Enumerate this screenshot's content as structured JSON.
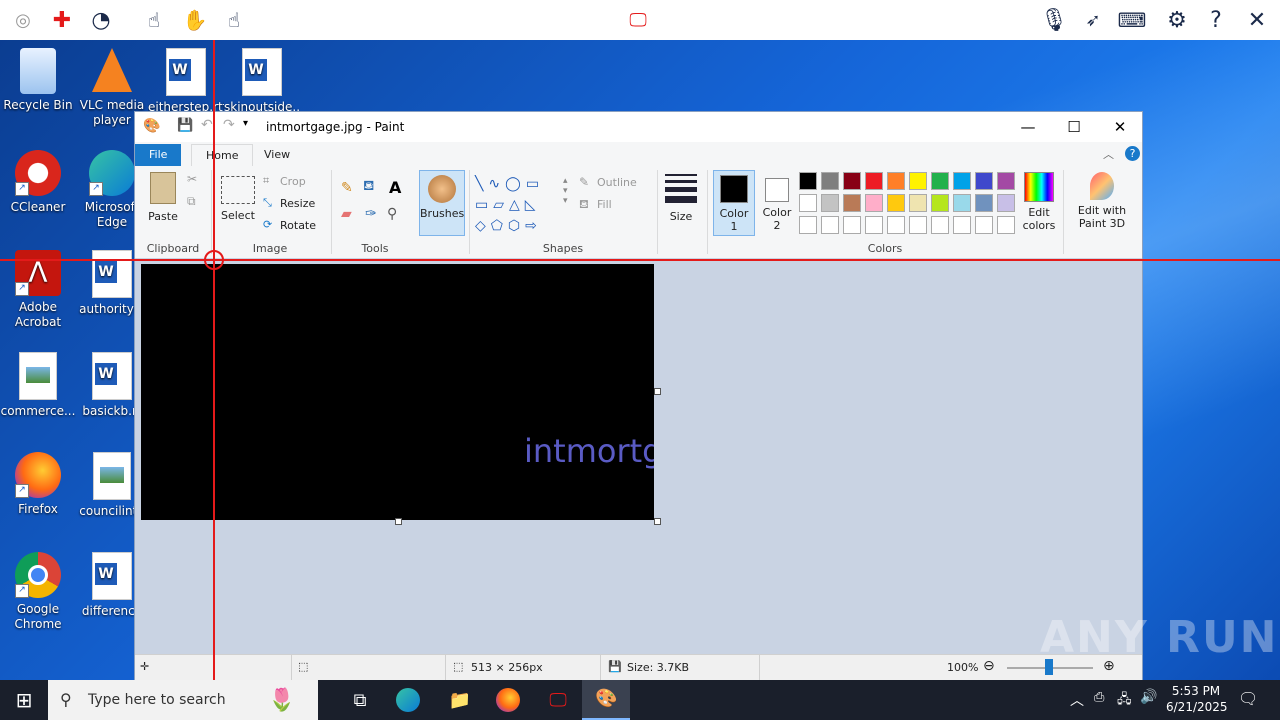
{
  "toolbar": {
    "icons": [
      "webcam-icon",
      "target-icon",
      "gauge-icon",
      "hand-click-icon",
      "hand-double-click-icon",
      "hand-hold-icon",
      "remote-desktop-icon",
      "microphone-icon",
      "pointer-icon",
      "keyboard-icon",
      "gear-icon",
      "help-icon",
      "close-icon"
    ]
  },
  "desktop": {
    "icons": [
      {
        "label": "Recycle Bin"
      },
      {
        "label": "VLC media player"
      },
      {
        "label": "eitherstep.rtf"
      },
      {
        "label": "skinoutside..."
      },
      {
        "label": "CCleaner"
      },
      {
        "label": "Microsoft Edge"
      },
      {
        "label": "Adobe Acrobat"
      },
      {
        "label": "authorityst"
      },
      {
        "label": "commerce..."
      },
      {
        "label": "basickb.rt"
      },
      {
        "label": "Firefox"
      },
      {
        "label": "councilinte"
      },
      {
        "label": "Google Chrome"
      },
      {
        "label": "difference"
      }
    ]
  },
  "paint": {
    "title": "intmortgage.jpg - Paint",
    "tabs": {
      "file": "File",
      "home": "Home",
      "view": "View"
    },
    "ribbon": {
      "paste": "Paste",
      "select": "Select",
      "crop": "Crop",
      "resize": "Resize",
      "rotate": "Rotate",
      "brushes": "Brushes",
      "outline": "Outline",
      "fill": "Fill",
      "size": "Size",
      "color1": "Color 1",
      "color2": "Color 2",
      "edit_colors": "Edit colors",
      "edit_paint3d": "Edit with Paint 3D",
      "groups": {
        "clipboard": "Clipboard",
        "image": "Image",
        "tools": "Tools",
        "shapes": "Shapes",
        "colors": "Colors"
      },
      "palette_row1": [
        "#000000",
        "#7f7f7f",
        "#880015",
        "#ed1c24",
        "#ff7f27",
        "#fff200",
        "#22b14c",
        "#00a2e8",
        "#3f48cc",
        "#a349a4"
      ],
      "palette_row2": [
        "#ffffff",
        "#c3c3c3",
        "#b97a57",
        "#ffaec9",
        "#ffc90e",
        "#efe4b0",
        "#b5e61d",
        "#99d9ea",
        "#7092be",
        "#c8bfe7"
      ]
    },
    "image_text": "intmortgage",
    "status": {
      "dimensions": "513 × 256px",
      "size": "Size: 3.7KB",
      "zoom": "100%"
    }
  },
  "taskbar": {
    "search_placeholder": "Type here to search",
    "time": "5:53 PM",
    "date": "6/21/2025"
  },
  "watermark": "ANY RUN"
}
